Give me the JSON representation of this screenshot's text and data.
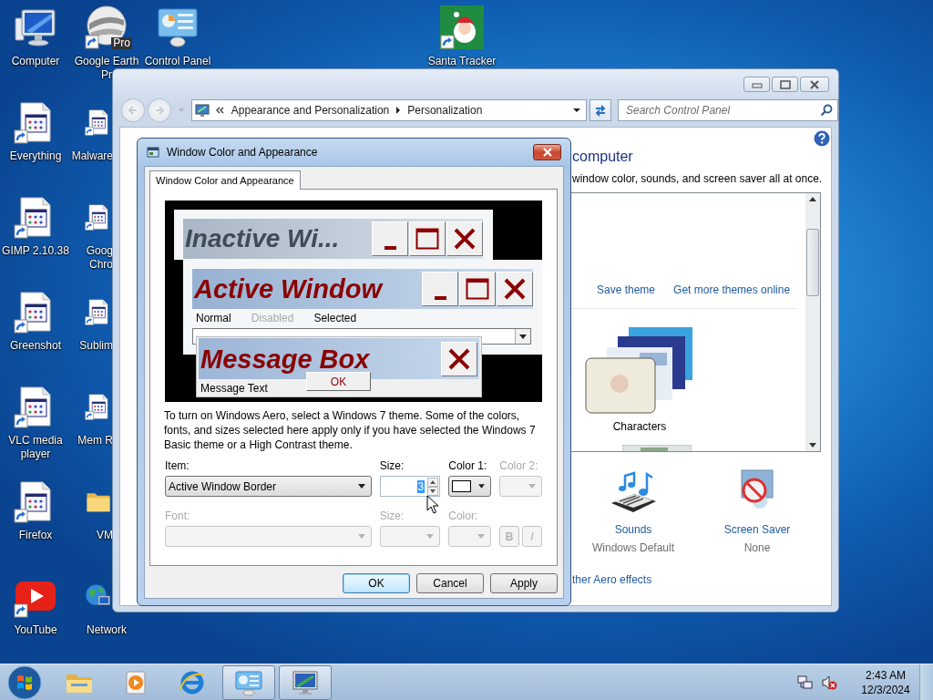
{
  "desktop": {
    "columns": [
      [
        {
          "label": "Computer",
          "kind": "computer",
          "shortcut": false
        },
        {
          "label": "Everything",
          "kind": "app",
          "shortcut": true
        },
        {
          "label": "GIMP 2.10.38",
          "kind": "app",
          "shortcut": true
        },
        {
          "label": "Greenshot",
          "kind": "app",
          "shortcut": true
        },
        {
          "label": "VLC media player",
          "kind": "app",
          "shortcut": true
        },
        {
          "label": "Firefox",
          "kind": "app",
          "shortcut": true
        },
        {
          "label": "YouTube",
          "kind": "youtube",
          "shortcut": true
        }
      ],
      [
        {
          "label": "Google Earth Pr",
          "kind": "earth",
          "shortcut": true,
          "badge": "Pro"
        },
        {
          "label": "Malware",
          "kind": "app",
          "shortcut": true,
          "cut": true
        },
        {
          "label": "Goog Chro",
          "kind": "app",
          "shortcut": true,
          "cut": true
        },
        {
          "label": "Sublim",
          "kind": "app",
          "shortcut": true,
          "cut": true
        },
        {
          "label": "Mem R",
          "kind": "app",
          "shortcut": true,
          "cut": true
        },
        {
          "label": "VM",
          "kind": "folder",
          "shortcut": false,
          "cut": true
        },
        {
          "label": "Network",
          "kind": "network",
          "shortcut": false
        }
      ],
      [
        {
          "label": "Control Panel",
          "kind": "control-panel",
          "shortcut": false
        }
      ]
    ],
    "loose_icons": [
      {
        "label": "Santa Tracker",
        "kind": "santa",
        "shortcut": true
      }
    ]
  },
  "control_panel": {
    "address": {
      "crumbs": [
        "Appearance and Personalization",
        "Personalization"
      ]
    },
    "search": {
      "placeholder": "Search Control Panel"
    },
    "heading": "computer",
    "subtitle": "window color, sounds, and screen saver all at once.",
    "theme_links": [
      "Save theme",
      "Get more themes online"
    ],
    "themes": [
      {
        "label": "Characters",
        "kind": "picture"
      }
    ],
    "settings": [
      {
        "label": "Sounds",
        "value": "Windows Default",
        "kind": "sounds"
      },
      {
        "label": "Screen Saver",
        "value": "None",
        "kind": "screensaver"
      }
    ],
    "aero_link": "ther Aero effects"
  },
  "dialog": {
    "title": "Window Color and Appearance",
    "tabs": [
      {
        "label": "Window Color and Appearance",
        "selected": true
      }
    ],
    "preview": {
      "inactive_title": "Inactive Wi...",
      "active_title": "Active Window",
      "menu": [
        {
          "label": "Normal",
          "disabled": false
        },
        {
          "label": "Disabled",
          "disabled": true
        },
        {
          "label": "Selected",
          "disabled": false
        }
      ],
      "message_title": "Message Box",
      "message_text": "Message Text",
      "ok_button": "OK"
    },
    "description": "To turn on Windows Aero, select a Windows 7 theme.  Some of the colors, fonts, and sizes selected here apply only if you have selected the Windows 7 Basic theme or a High Contrast theme.",
    "row_1": [
      {
        "label": "Item:",
        "kind": "select",
        "value": "Active Window Border",
        "disabled": false
      },
      {
        "label": "Size:",
        "kind": "spin",
        "value": "3",
        "focused": true,
        "disabled": false
      },
      {
        "label": "Color 1:",
        "kind": "color",
        "color": "#ffffff",
        "disabled": false
      },
      {
        "label": "Color 2:",
        "kind": "color",
        "disabled": true
      }
    ],
    "row_2": [
      {
        "label": "Font:",
        "kind": "select",
        "disabled": true
      },
      {
        "label": "Size:",
        "kind": "size-select",
        "disabled": true
      },
      {
        "label": "Color:",
        "kind": "color",
        "disabled": true
      }
    ],
    "style_buttons": [
      {
        "label": "B",
        "kind": "bold",
        "disabled": true
      },
      {
        "label": "I",
        "kind": "italic",
        "disabled": true
      }
    ],
    "buttons": [
      {
        "label": "OK",
        "default": true
      },
      {
        "label": "Cancel",
        "default": false
      },
      {
        "label": "Apply",
        "default": false
      }
    ]
  },
  "taskbar": {
    "items": [
      {
        "kind": "explorer",
        "open": false
      },
      {
        "kind": "media",
        "open": false
      },
      {
        "kind": "ie",
        "open": false
      },
      {
        "kind": "control-panel",
        "open": true
      },
      {
        "kind": "display",
        "open": true
      }
    ],
    "tray": [
      {
        "kind": "network"
      },
      {
        "kind": "volume",
        "muted": true
      }
    ],
    "time": "2:43 AM",
    "date": "12/3/2024"
  }
}
